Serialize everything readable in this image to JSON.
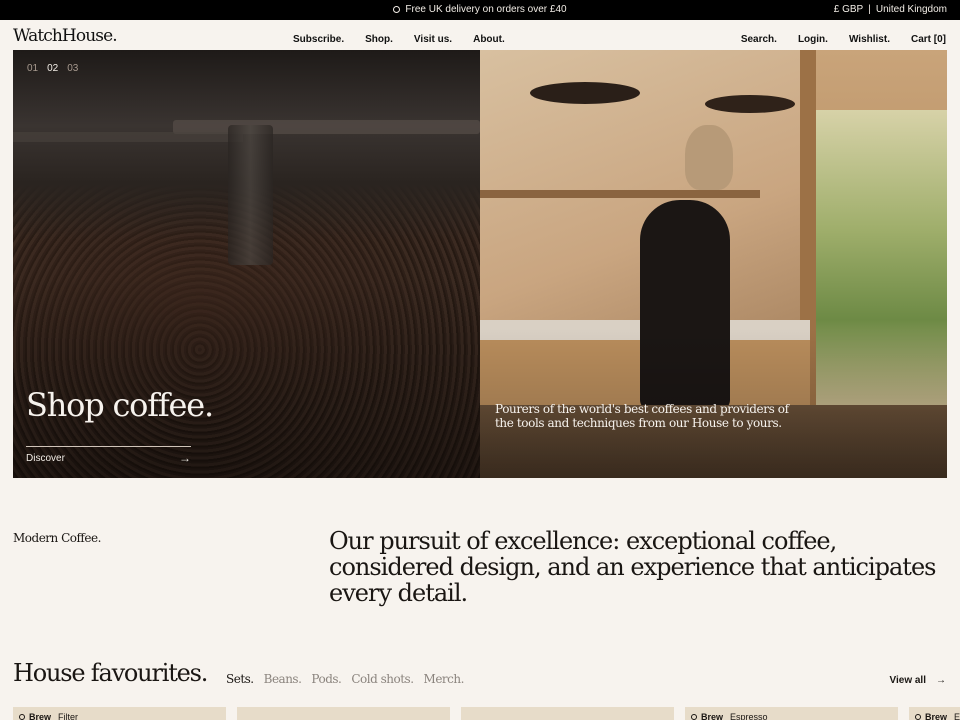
{
  "announcement": {
    "message": "Free UK delivery on orders over £40",
    "currency": "£ GBP",
    "separator": "|",
    "country": "United Kingdom"
  },
  "header": {
    "logo": "WatchHouse.",
    "nav_left": [
      "Subscribe.",
      "Shop.",
      "Visit us.",
      "About."
    ],
    "nav_right": [
      "Search.",
      "Login.",
      "Wishlist.",
      "Cart [0]"
    ]
  },
  "hero": {
    "slides": [
      "01",
      "02",
      "03"
    ],
    "active_slide": "02",
    "title": "Shop coffee.",
    "cta_label": "Discover",
    "cta_arrow": "→",
    "caption": "Pourers of the world's best coffees and providers of the tools and techniques from our House to yours."
  },
  "intro": {
    "eyebrow": "Modern Coffee.",
    "statement": "Our pursuit of excellence: exceptional coffee, considered design, and an experience that anticipates every detail."
  },
  "favourites": {
    "title": "House favourites.",
    "tabs": [
      "Sets.",
      "Beans.",
      "Pods.",
      "Cold shots.",
      "Merch."
    ],
    "active_tab": "Sets.",
    "view_all": "View all",
    "view_all_arrow": "→",
    "cards": [
      {
        "tag": "Brew",
        "method": "Filter"
      },
      {
        "tag": "",
        "method": ""
      },
      {
        "tag": "",
        "method": ""
      },
      {
        "tag": "Brew",
        "method": "Espresso"
      },
      {
        "tag": "Brew",
        "method": "E"
      }
    ]
  },
  "colors": {
    "background": "#f7f3ee",
    "announcement_bg": "#000000",
    "text": "#1a1613",
    "muted_tab": "#8b847e"
  }
}
